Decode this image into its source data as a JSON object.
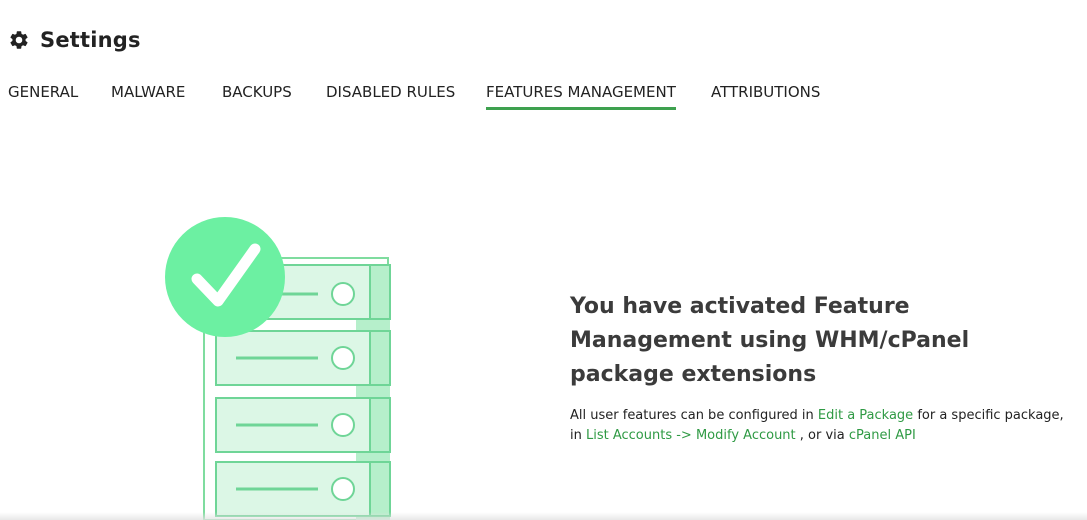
{
  "header": {
    "title": "Settings",
    "icon": "gear-icon"
  },
  "tabs": [
    {
      "label": "GENERAL",
      "active": false
    },
    {
      "label": "MALWARE",
      "active": false
    },
    {
      "label": "BACKUPS",
      "active": false
    },
    {
      "label": "DISABLED RULES",
      "active": false
    },
    {
      "label": "FEATURES MANAGEMENT",
      "active": true
    },
    {
      "label": "ATTRIBUTIONS",
      "active": false
    }
  ],
  "main": {
    "illustration": "server-check-icon",
    "heading": "You have activated Feature Management using WHM/cPanel package extensions",
    "desc": {
      "part1": "All user features can be configured in ",
      "link1": "Edit a Package",
      "part2": " for a specific package, in ",
      "link2": "List Accounts -> Modify Account",
      "part3": " , or via ",
      "link3": "cPanel API"
    }
  },
  "colors": {
    "accent": "#3ea14f",
    "link": "#2f9a44",
    "check_circle": "#6cf0a2",
    "server_fill": "#dcf7e6",
    "server_stroke": "#7fdc9f"
  }
}
